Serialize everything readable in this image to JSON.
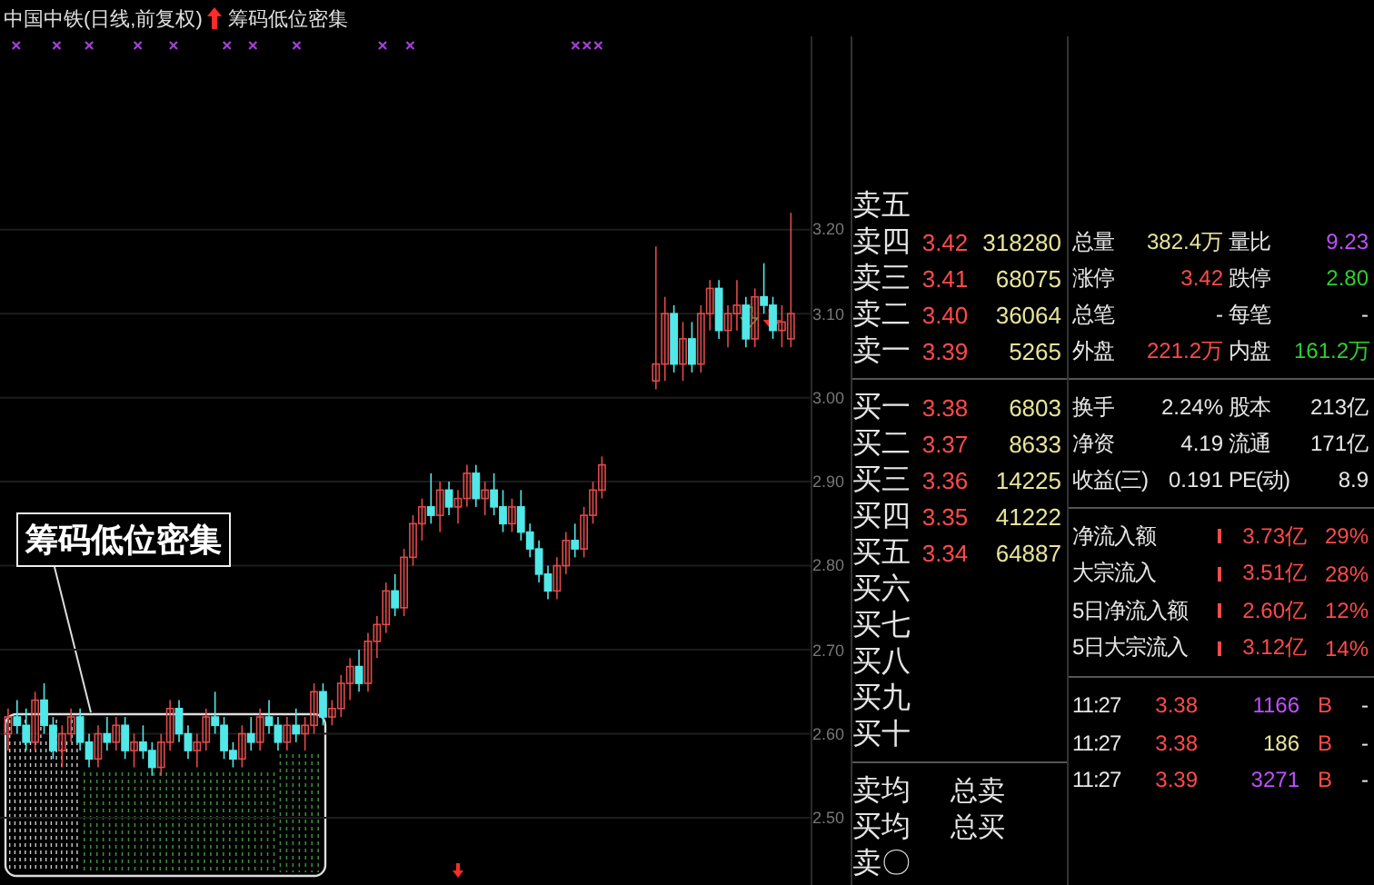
{
  "title": {
    "stock": "中国中铁(日线,前复权)",
    "indicator": "筹码低位密集"
  },
  "callout": {
    "label": "筹码低位密集"
  },
  "chart_data": {
    "type": "candlestick",
    "ylim": [
      2.42,
      3.43
    ],
    "grid": true,
    "yticks": [
      {
        "value": 3.2,
        "label": "3.20"
      },
      {
        "value": 3.1,
        "label": "3.10"
      },
      {
        "value": 3.0,
        "label": "3.00"
      },
      {
        "value": 2.9,
        "label": "2.90"
      },
      {
        "value": 2.8,
        "label": "2.80"
      },
      {
        "value": 2.7,
        "label": "2.70"
      },
      {
        "value": 2.6,
        "label": "2.60"
      },
      {
        "value": 2.5,
        "label": "2.50"
      }
    ],
    "ohlc": [
      [
        2.6,
        2.63,
        2.58,
        2.62
      ],
      [
        2.62,
        2.64,
        2.6,
        2.61
      ],
      [
        2.61,
        2.63,
        2.58,
        2.59
      ],
      [
        2.59,
        2.65,
        2.58,
        2.64
      ],
      [
        2.64,
        2.66,
        2.6,
        2.61
      ],
      [
        2.61,
        2.62,
        2.57,
        2.58
      ],
      [
        2.58,
        2.61,
        2.56,
        2.6
      ],
      [
        2.6,
        2.63,
        2.59,
        2.62
      ],
      [
        2.62,
        2.63,
        2.58,
        2.59
      ],
      [
        2.59,
        2.6,
        2.56,
        2.57
      ],
      [
        2.57,
        2.61,
        2.56,
        2.6
      ],
      [
        2.6,
        2.62,
        2.58,
        2.59
      ],
      [
        2.59,
        2.62,
        2.58,
        2.61
      ],
      [
        2.61,
        2.62,
        2.57,
        2.58
      ],
      [
        2.58,
        2.6,
        2.56,
        2.59
      ],
      [
        2.59,
        2.61,
        2.57,
        2.58
      ],
      [
        2.58,
        2.59,
        2.55,
        2.56
      ],
      [
        2.56,
        2.6,
        2.55,
        2.59
      ],
      [
        2.59,
        2.64,
        2.58,
        2.63
      ],
      [
        2.63,
        2.64,
        2.59,
        2.6
      ],
      [
        2.6,
        2.61,
        2.57,
        2.58
      ],
      [
        2.58,
        2.6,
        2.56,
        2.59
      ],
      [
        2.59,
        2.63,
        2.58,
        2.62
      ],
      [
        2.62,
        2.65,
        2.6,
        2.61
      ],
      [
        2.61,
        2.62,
        2.57,
        2.58
      ],
      [
        2.58,
        2.59,
        2.56,
        2.57
      ],
      [
        2.57,
        2.61,
        2.56,
        2.6
      ],
      [
        2.6,
        2.62,
        2.58,
        2.59
      ],
      [
        2.59,
        2.63,
        2.58,
        2.62
      ],
      [
        2.62,
        2.64,
        2.6,
        2.61
      ],
      [
        2.61,
        2.62,
        2.58,
        2.59
      ],
      [
        2.59,
        2.62,
        2.58,
        2.61
      ],
      [
        2.61,
        2.63,
        2.59,
        2.6
      ],
      [
        2.6,
        2.62,
        2.58,
        2.61
      ],
      [
        2.61,
        2.66,
        2.6,
        2.65
      ],
      [
        2.65,
        2.66,
        2.61,
        2.62
      ],
      [
        2.62,
        2.64,
        2.61,
        2.63
      ],
      [
        2.63,
        2.67,
        2.62,
        2.66
      ],
      [
        2.66,
        2.69,
        2.64,
        2.68
      ],
      [
        2.68,
        2.7,
        2.65,
        2.66
      ],
      [
        2.66,
        2.72,
        2.65,
        2.71
      ],
      [
        2.71,
        2.74,
        2.69,
        2.73
      ],
      [
        2.73,
        2.78,
        2.72,
        2.77
      ],
      [
        2.77,
        2.79,
        2.74,
        2.75
      ],
      [
        2.75,
        2.82,
        2.74,
        2.81
      ],
      [
        2.81,
        2.86,
        2.8,
        2.85
      ],
      [
        2.85,
        2.88,
        2.83,
        2.87
      ],
      [
        2.87,
        2.91,
        2.85,
        2.86
      ],
      [
        2.86,
        2.9,
        2.84,
        2.89
      ],
      [
        2.89,
        2.9,
        2.86,
        2.87
      ],
      [
        2.87,
        2.89,
        2.85,
        2.88
      ],
      [
        2.88,
        2.92,
        2.87,
        2.91
      ],
      [
        2.91,
        2.92,
        2.87,
        2.88
      ],
      [
        2.88,
        2.9,
        2.86,
        2.89
      ],
      [
        2.89,
        2.91,
        2.86,
        2.87
      ],
      [
        2.87,
        2.89,
        2.84,
        2.85
      ],
      [
        2.85,
        2.88,
        2.84,
        2.87
      ],
      [
        2.87,
        2.89,
        2.83,
        2.84
      ],
      [
        2.84,
        2.85,
        2.81,
        2.82
      ],
      [
        2.82,
        2.83,
        2.78,
        2.79
      ],
      [
        2.79,
        2.8,
        2.76,
        2.77
      ],
      [
        2.77,
        2.81,
        2.76,
        2.8
      ],
      [
        2.8,
        2.84,
        2.79,
        2.83
      ],
      [
        2.83,
        2.85,
        2.81,
        2.82
      ],
      [
        2.82,
        2.87,
        2.81,
        2.86
      ],
      [
        2.86,
        2.9,
        2.85,
        2.89
      ],
      [
        2.89,
        2.93,
        2.88,
        2.92
      ],
      null,
      null,
      null,
      null,
      null,
      [
        3.02,
        3.18,
        3.01,
        3.04
      ],
      [
        3.04,
        3.12,
        3.02,
        3.1
      ],
      [
        3.1,
        3.11,
        3.03,
        3.04
      ],
      [
        3.04,
        3.09,
        3.02,
        3.07
      ],
      [
        3.07,
        3.09,
        3.03,
        3.04
      ],
      [
        3.04,
        3.11,
        3.03,
        3.1
      ],
      [
        3.1,
        3.14,
        3.08,
        3.13
      ],
      [
        3.13,
        3.14,
        3.07,
        3.08
      ],
      [
        3.08,
        3.11,
        3.06,
        3.1
      ],
      [
        3.1,
        3.14,
        3.08,
        3.11
      ],
      [
        3.11,
        3.12,
        3.06,
        3.07
      ],
      [
        3.07,
        3.13,
        3.06,
        3.12
      ],
      [
        3.12,
        3.16,
        3.1,
        3.11
      ],
      [
        3.11,
        3.12,
        3.07,
        3.08
      ],
      [
        3.08,
        3.11,
        3.06,
        3.09
      ],
      [
        3.07,
        3.22,
        3.06,
        3.1
      ]
    ]
  },
  "order_book": {
    "asks": [
      {
        "label": "卖五"
      },
      {
        "label": "卖四",
        "price": "3.42",
        "volume": "318280"
      },
      {
        "label": "卖三",
        "price": "3.41",
        "volume": "68075"
      },
      {
        "label": "卖二",
        "price": "3.40",
        "volume": "36064"
      },
      {
        "label": "卖一",
        "price": "3.39",
        "volume": "5265"
      }
    ],
    "bids": [
      {
        "label": "买一",
        "price": "3.38",
        "volume": "6803"
      },
      {
        "label": "买二",
        "price": "3.37",
        "volume": "8633"
      },
      {
        "label": "买三",
        "price": "3.36",
        "volume": "14225"
      },
      {
        "label": "买四",
        "price": "3.35",
        "volume": "41222"
      },
      {
        "label": "买五",
        "price": "3.34",
        "volume": "64887"
      },
      {
        "label": "买六"
      },
      {
        "label": "买七"
      },
      {
        "label": "买八"
      },
      {
        "label": "买九"
      },
      {
        "label": "买十"
      }
    ],
    "summary": [
      {
        "label": "卖均",
        "total_label": "总卖"
      },
      {
        "label": "买均",
        "total_label": "总买"
      },
      {
        "label": "卖〇"
      }
    ]
  },
  "stats": {
    "quote": [
      {
        "left": {
          "label": "总量",
          "value": "382.4万",
          "color": "#e8e49a"
        },
        "right": {
          "label": "量比",
          "value": "9.23",
          "color": "#c050ff"
        }
      },
      {
        "left": {
          "label": "涨停",
          "value": "3.42",
          "color": "#ff4a4a"
        },
        "right": {
          "label": "跌停",
          "value": "2.80",
          "color": "#2ed02e"
        }
      },
      {
        "left": {
          "label": "总笔",
          "value": "-",
          "color": "#e6e6e6"
        },
        "right": {
          "label": "每笔",
          "value": "-",
          "color": "#e6e6e6"
        }
      },
      {
        "left": {
          "label": "外盘",
          "value": "221.2万",
          "color": "#ff4a4a"
        },
        "right": {
          "label": "内盘",
          "value": "161.2万",
          "color": "#2ed02e"
        }
      }
    ],
    "fundamentals": [
      {
        "left": {
          "label": "换手",
          "value": "2.24%",
          "color": "#e6e6e6"
        },
        "right": {
          "label": "股本",
          "value": "213亿",
          "color": "#e6e6e6"
        }
      },
      {
        "left": {
          "label": "净资",
          "value": "4.19",
          "color": "#e6e6e6"
        },
        "right": {
          "label": "流通",
          "value": "171亿",
          "color": "#e6e6e6"
        }
      },
      {
        "left": {
          "label": "收益(三)",
          "value": "0.191",
          "color": "#e6e6e6"
        },
        "right": {
          "label": "PE(动)",
          "value": "8.9",
          "color": "#e6e6e6"
        }
      }
    ],
    "flows": [
      {
        "label": "净流入额",
        "value": "3.73亿",
        "share": "29%"
      },
      {
        "label": "大宗流入",
        "value": "3.51亿",
        "share": "28%"
      },
      {
        "label": "5日净流入额",
        "value": "2.60亿",
        "share": "12%"
      },
      {
        "label": "5日大宗流入",
        "value": "3.12亿",
        "share": "14%"
      }
    ],
    "trades": [
      {
        "time": "11:27",
        "price": "3.38",
        "volume": "1166",
        "color": "#c050ff",
        "side": "B",
        "change": "-"
      },
      {
        "time": "11:27",
        "price": "3.38",
        "volume": "186",
        "color": "#e8e49a",
        "side": "B",
        "change": "-"
      },
      {
        "time": "11:27",
        "price": "3.39",
        "volume": "3271",
        "color": "#c050ff",
        "side": "B",
        "change": "-"
      }
    ]
  }
}
